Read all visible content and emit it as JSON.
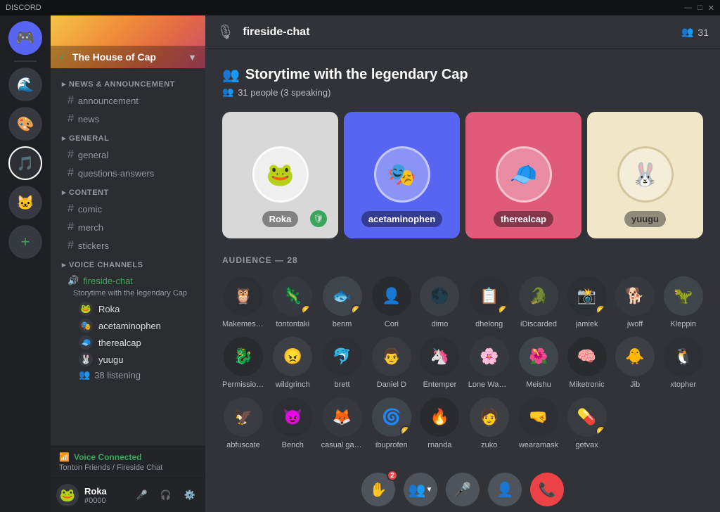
{
  "titlebar": {
    "title": "DISCORD",
    "controls": [
      "—",
      "□",
      "✕"
    ]
  },
  "servers": [
    {
      "id": "home",
      "icon": "🏠",
      "active": false
    },
    {
      "id": "server1",
      "icon": "🎮",
      "active": false
    },
    {
      "id": "server2",
      "icon": "🌊",
      "active": false
    },
    {
      "id": "server3",
      "icon": "🎵",
      "active": false
    },
    {
      "id": "server4",
      "icon": "🐱",
      "active": true
    },
    {
      "id": "server5",
      "icon": "🎨",
      "active": false
    }
  ],
  "serverName": "The House of Cap",
  "serverVerified": true,
  "categories": {
    "newsAnnouncement": "NEWS & ANNOUNCEMENT",
    "newsChannels": [
      "announcement",
      "news"
    ],
    "general": "GENERAL",
    "generalChannels": [
      "general",
      "questions-answers"
    ],
    "content": "CONTENT",
    "contentChannels": [
      "comic",
      "merch",
      "stickers"
    ],
    "voiceChannels": "VOICE CHANNELS"
  },
  "activeVoiceChannel": {
    "name": "fireside-chat",
    "subtitle": "Storytime with the legendary Cap",
    "members": [
      "Roka",
      "acetaminophen",
      "therealcap",
      "yuugu"
    ],
    "listeningCount": "38 listening"
  },
  "voiceStatus": {
    "connected": "Voice Connected",
    "subtitle": "Tonton Friends / Fireside Chat"
  },
  "currentUser": {
    "name": "Roka",
    "tag": "#0000",
    "avatar": "🐸"
  },
  "channelHeader": {
    "icon": "🎙️",
    "name": "fireside-chat",
    "memberCount": "31"
  },
  "stage": {
    "title": "Storytime with the legendary Cap",
    "subtitle": "31 people (3 speaking)",
    "speakers": [
      {
        "name": "Roka",
        "avatar": "🐸",
        "color": "roka",
        "mod": true
      },
      {
        "name": "acetaminophen",
        "avatar": "🎭",
        "color": "blue"
      },
      {
        "name": "therealcap",
        "avatar": "🧢",
        "color": "pink"
      },
      {
        "name": "yuugu",
        "avatar": "🐰",
        "color": "cream"
      }
    ],
    "audienceLabel": "AUDIENCE — 28",
    "audienceCount": 28,
    "audienceMembers": [
      {
        "name": "Makemespeakrr",
        "avatar": "🦉",
        "badge": null
      },
      {
        "name": "tontontaki",
        "avatar": "🦎",
        "badge": "🔴"
      },
      {
        "name": "benm",
        "avatar": "🐟",
        "badge": "🔴"
      },
      {
        "name": "Cori",
        "avatar": "👤",
        "badge": null
      },
      {
        "name": "dimo",
        "avatar": "🌑",
        "badge": null
      },
      {
        "name": "dhelong",
        "avatar": "📋",
        "badge": "🔔"
      },
      {
        "name": "iDiscarded",
        "avatar": "🐊",
        "badge": null
      },
      {
        "name": "jamiek",
        "avatar": "📸",
        "badge": "🔔"
      },
      {
        "name": "jwoff",
        "avatar": "🐕",
        "badge": null
      },
      {
        "name": "Kleppin",
        "avatar": "🦖",
        "badge": null
      },
      {
        "name": "Permission Man",
        "avatar": "🐉",
        "badge": null
      },
      {
        "name": "wildgrinch",
        "avatar": "😠",
        "badge": null
      },
      {
        "name": "brett",
        "avatar": "🐬",
        "badge": null
      },
      {
        "name": "Daniel D",
        "avatar": "👨",
        "badge": null
      },
      {
        "name": "Entemper",
        "avatar": "🦄",
        "badge": null
      },
      {
        "name": "Lone Wanderer",
        "avatar": "🌸",
        "badge": null
      },
      {
        "name": "Meishu",
        "avatar": "🌺",
        "badge": null
      },
      {
        "name": "Miketronic",
        "avatar": "🧠",
        "badge": null
      },
      {
        "name": "Jib",
        "avatar": "🐥",
        "badge": null
      },
      {
        "name": "xtopher",
        "avatar": "🐧",
        "badge": null
      },
      {
        "name": "abfuscate",
        "avatar": "🦅",
        "badge": null
      },
      {
        "name": "Bench",
        "avatar": "😈",
        "badge": null
      },
      {
        "name": "casual gamer",
        "avatar": "🦊",
        "badge": null
      },
      {
        "name": "ibuprofen",
        "avatar": "🌀",
        "badge": "🔔"
      },
      {
        "name": "rnanda",
        "avatar": "🔥",
        "badge": null
      },
      {
        "name": "zuko",
        "avatar": "🧑",
        "badge": null
      },
      {
        "name": "wearamask",
        "avatar": "🤜",
        "badge": null
      },
      {
        "name": "getvax",
        "avatar": "💊",
        "badge": "🔔"
      }
    ]
  },
  "controls": [
    {
      "id": "raise-hand",
      "icon": "✋",
      "badge": "2"
    },
    {
      "id": "members",
      "icon": "👥",
      "badge": null
    },
    {
      "id": "mute",
      "icon": "🎤",
      "badge": null
    },
    {
      "id": "invite",
      "icon": "👤+",
      "badge": null
    },
    {
      "id": "leave",
      "icon": "📞",
      "badge": null,
      "red": true
    }
  ]
}
